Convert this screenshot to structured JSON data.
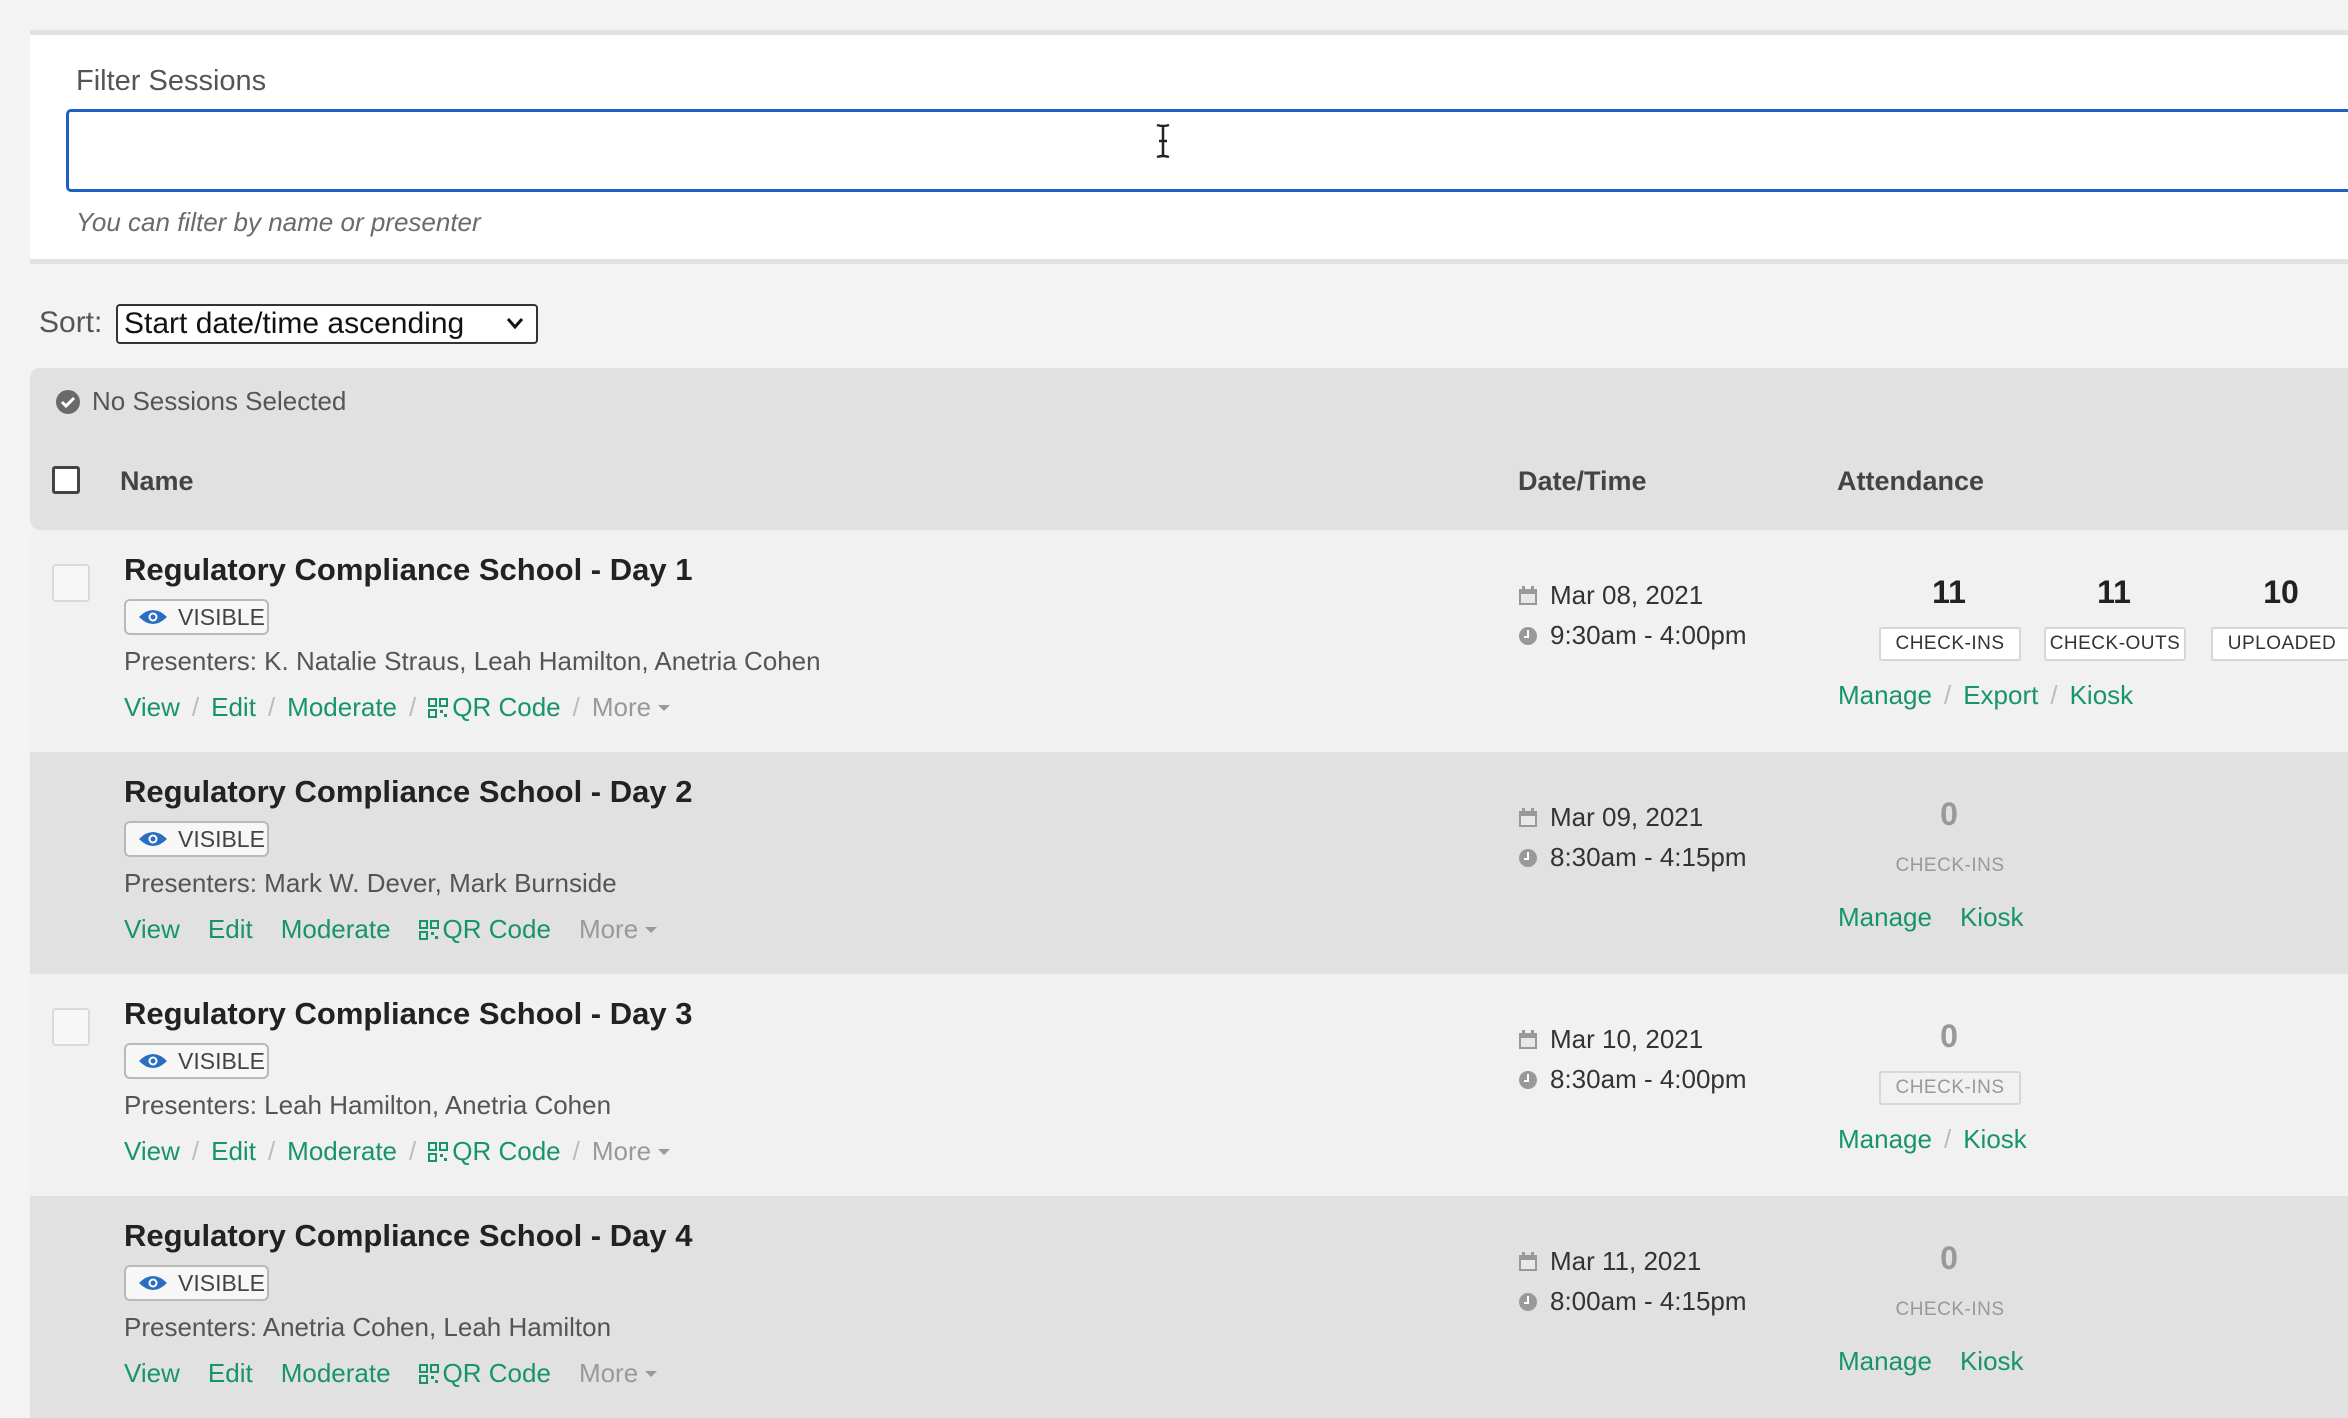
{
  "filter": {
    "label": "Filter Sessions",
    "value": "",
    "placeholder": "",
    "help": "You can filter by name or presenter"
  },
  "sort": {
    "label": "Sort:",
    "selected": "Start date/time ascending"
  },
  "table": {
    "selection_status": "No Sessions Selected",
    "columns": {
      "name": "Name",
      "datetime": "Date/Time",
      "attendance": "Attendance"
    }
  },
  "labels": {
    "visible": "VISIBLE",
    "view": "View",
    "edit": "Edit",
    "moderate": "Moderate",
    "qr": "QR Code",
    "more": "More",
    "manage": "Manage",
    "export": "Export",
    "kiosk": "Kiosk",
    "checkins": "CHECK-INS",
    "checkouts": "CHECK-OUTS",
    "uploaded": "UPLOADED"
  },
  "sessions": [
    {
      "name": "Regulatory Compliance School - Day 1",
      "presenters": "Presenters: K. Natalie Straus, Leah Hamilton, Anetria Cohen",
      "date": "Mar 08, 2021",
      "time": "9:30am - 4:00pm",
      "checkins": "11",
      "checkouts": "11",
      "uploaded": "10"
    },
    {
      "name": "Regulatory Compliance School - Day 2",
      "presenters": "Presenters: Mark W. Dever, Mark Burnside",
      "date": "Mar 09, 2021",
      "time": "8:30am - 4:15pm",
      "checkins": "0"
    },
    {
      "name": "Regulatory Compliance School - Day 3",
      "presenters": "Presenters: Leah Hamilton, Anetria Cohen",
      "date": "Mar 10, 2021",
      "time": "8:30am - 4:00pm",
      "checkins": "0"
    },
    {
      "name": "Regulatory Compliance School - Day 4",
      "presenters": "Presenters: Anetria Cohen, Leah Hamilton",
      "date": "Mar 11, 2021",
      "time": "8:00am - 4:15pm",
      "checkins": "0"
    }
  ],
  "colors": {
    "accent": "#17946d",
    "focus": "#1a63c4",
    "badge_eye": "#2a6fbf"
  }
}
